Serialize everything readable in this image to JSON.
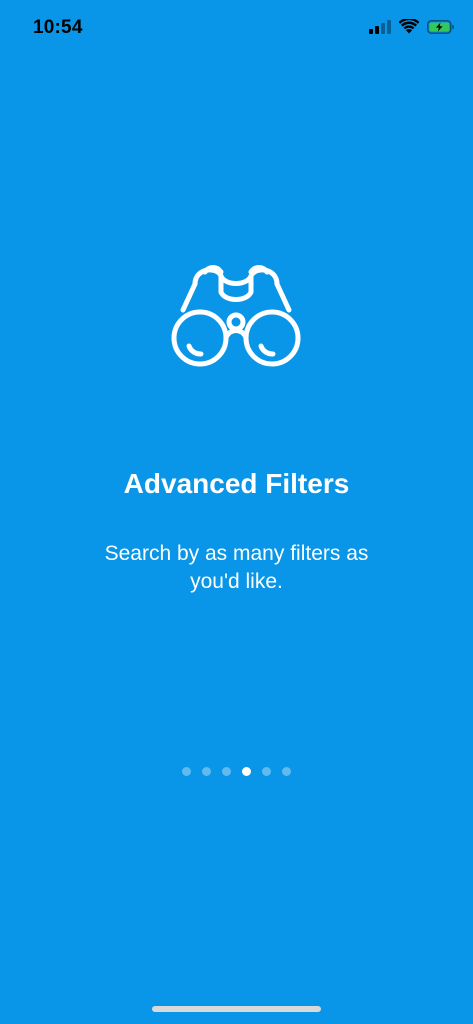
{
  "status_bar": {
    "time": "10:54",
    "signal_icon": "cellular-signal-icon",
    "wifi_icon": "wifi-icon",
    "battery_icon": "battery-charging-icon",
    "battery_color": "#34C759"
  },
  "onboarding": {
    "illustration_icon": "binoculars-icon",
    "title": "Advanced Filters",
    "subtitle": "Search by as many filters as you'd like."
  },
  "pagination": {
    "total_pages": 6,
    "current_page": 4
  },
  "colors": {
    "background": "#0A96E8",
    "text": "#FFFFFF"
  }
}
